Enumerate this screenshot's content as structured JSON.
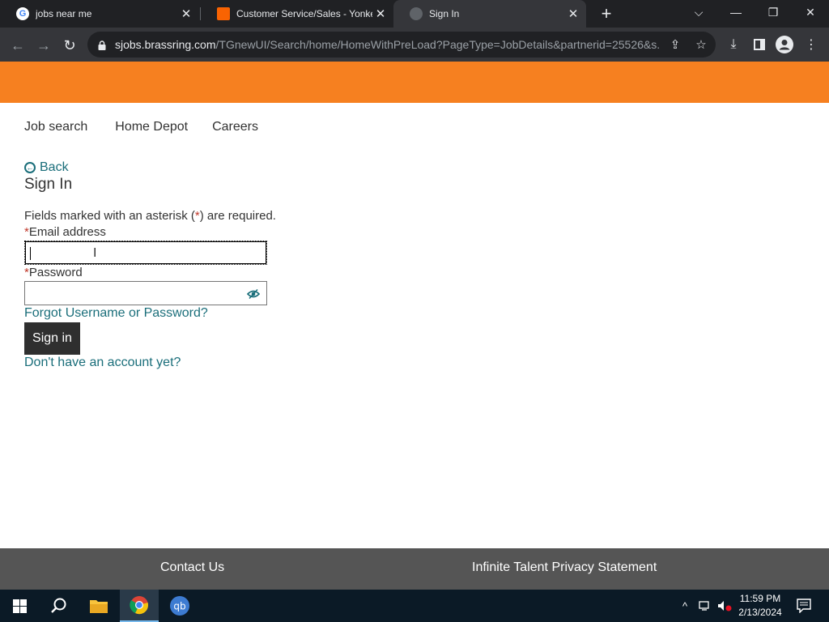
{
  "browser": {
    "tabs": [
      {
        "title": "jobs near me",
        "icon": "google-icon"
      },
      {
        "title": "Customer Service/Sales - Yonkers",
        "icon": "home-depot-icon"
      },
      {
        "title": "Sign In",
        "icon": "globe-icon"
      }
    ],
    "url_host": "sjobs.brassring.com",
    "url_path": "/TGnewUI/Search/home/HomeWithPreLoad?PageType=JobDetails&partnerid=25526&s..."
  },
  "page": {
    "brand_color": "#f68020",
    "nav": [
      "Job search",
      "Home Depot",
      "Careers"
    ],
    "back_label": "Back",
    "title": "Sign In",
    "required_note_prefix": "Fields marked with an asterisk (",
    "required_note_star": "*",
    "required_note_suffix": ") are required.",
    "email_label": "Email address",
    "email_value": "",
    "password_label": "Password",
    "password_value": "",
    "asterisk": "*",
    "forgot_link": "Forgot Username or Password?",
    "signin_button": "Sign in",
    "signup_link": "Don't have an account yet?",
    "link_color": "#1a6e7a"
  },
  "footer": {
    "contact": "Contact Us",
    "privacy": "Infinite Talent Privacy Statement"
  },
  "taskbar": {
    "time": "11:59 PM",
    "date": "2/13/2024"
  }
}
